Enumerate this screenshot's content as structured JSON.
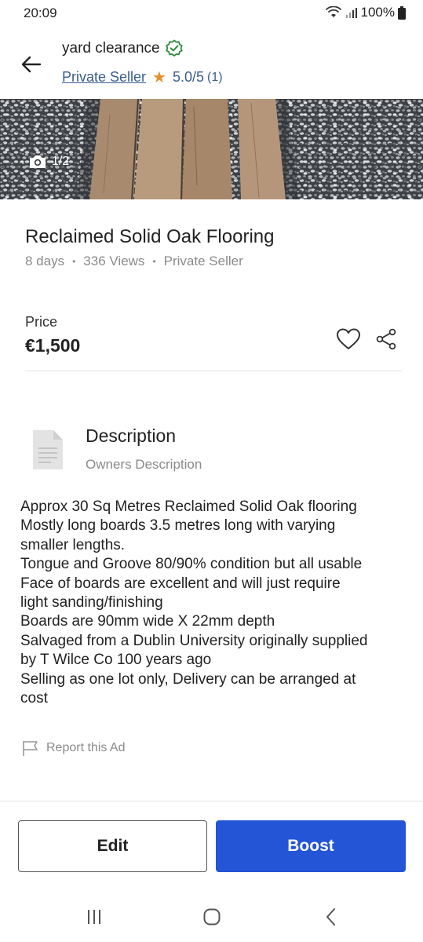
{
  "status_bar": {
    "time": "20:09",
    "battery": "100%"
  },
  "header": {
    "seller_name": "yard clearance",
    "seller_type": "Private Seller",
    "rating": "5.0/5",
    "rating_count": "(1)"
  },
  "hero": {
    "photo_counter": "1/2"
  },
  "listing": {
    "title": "Reclaimed Solid Oak Flooring",
    "age": "8 days",
    "views": "336 Views",
    "seller_type": "Private Seller"
  },
  "price": {
    "label": "Price",
    "value": "€1,500"
  },
  "description": {
    "title": "Description",
    "subtitle": "Owners Description",
    "lines": [
      "Approx 30 Sq Metres Reclaimed Solid Oak flooring",
      "Mostly long boards 3.5 metres long with varying",
      "smaller lengths.",
      "Tongue and Groove 80/90% condition but all usable",
      "Face of boards are excellent and will just require",
      "light sanding/finishing",
      "Boards are 90mm wide X 22mm depth",
      "Salvaged from a Dublin University originally supplied",
      "by T Wilce Co 100 years ago",
      "Selling as one lot only, Delivery can be arranged at",
      "cost"
    ]
  },
  "report": {
    "label": "Report this Ad"
  },
  "actions": {
    "edit_label": "Edit",
    "boost_label": "Boost"
  },
  "colors": {
    "accent": "#2455d6",
    "link": "#3a5d8f",
    "star": "#e6912c",
    "verified": "#2e8b3e"
  }
}
